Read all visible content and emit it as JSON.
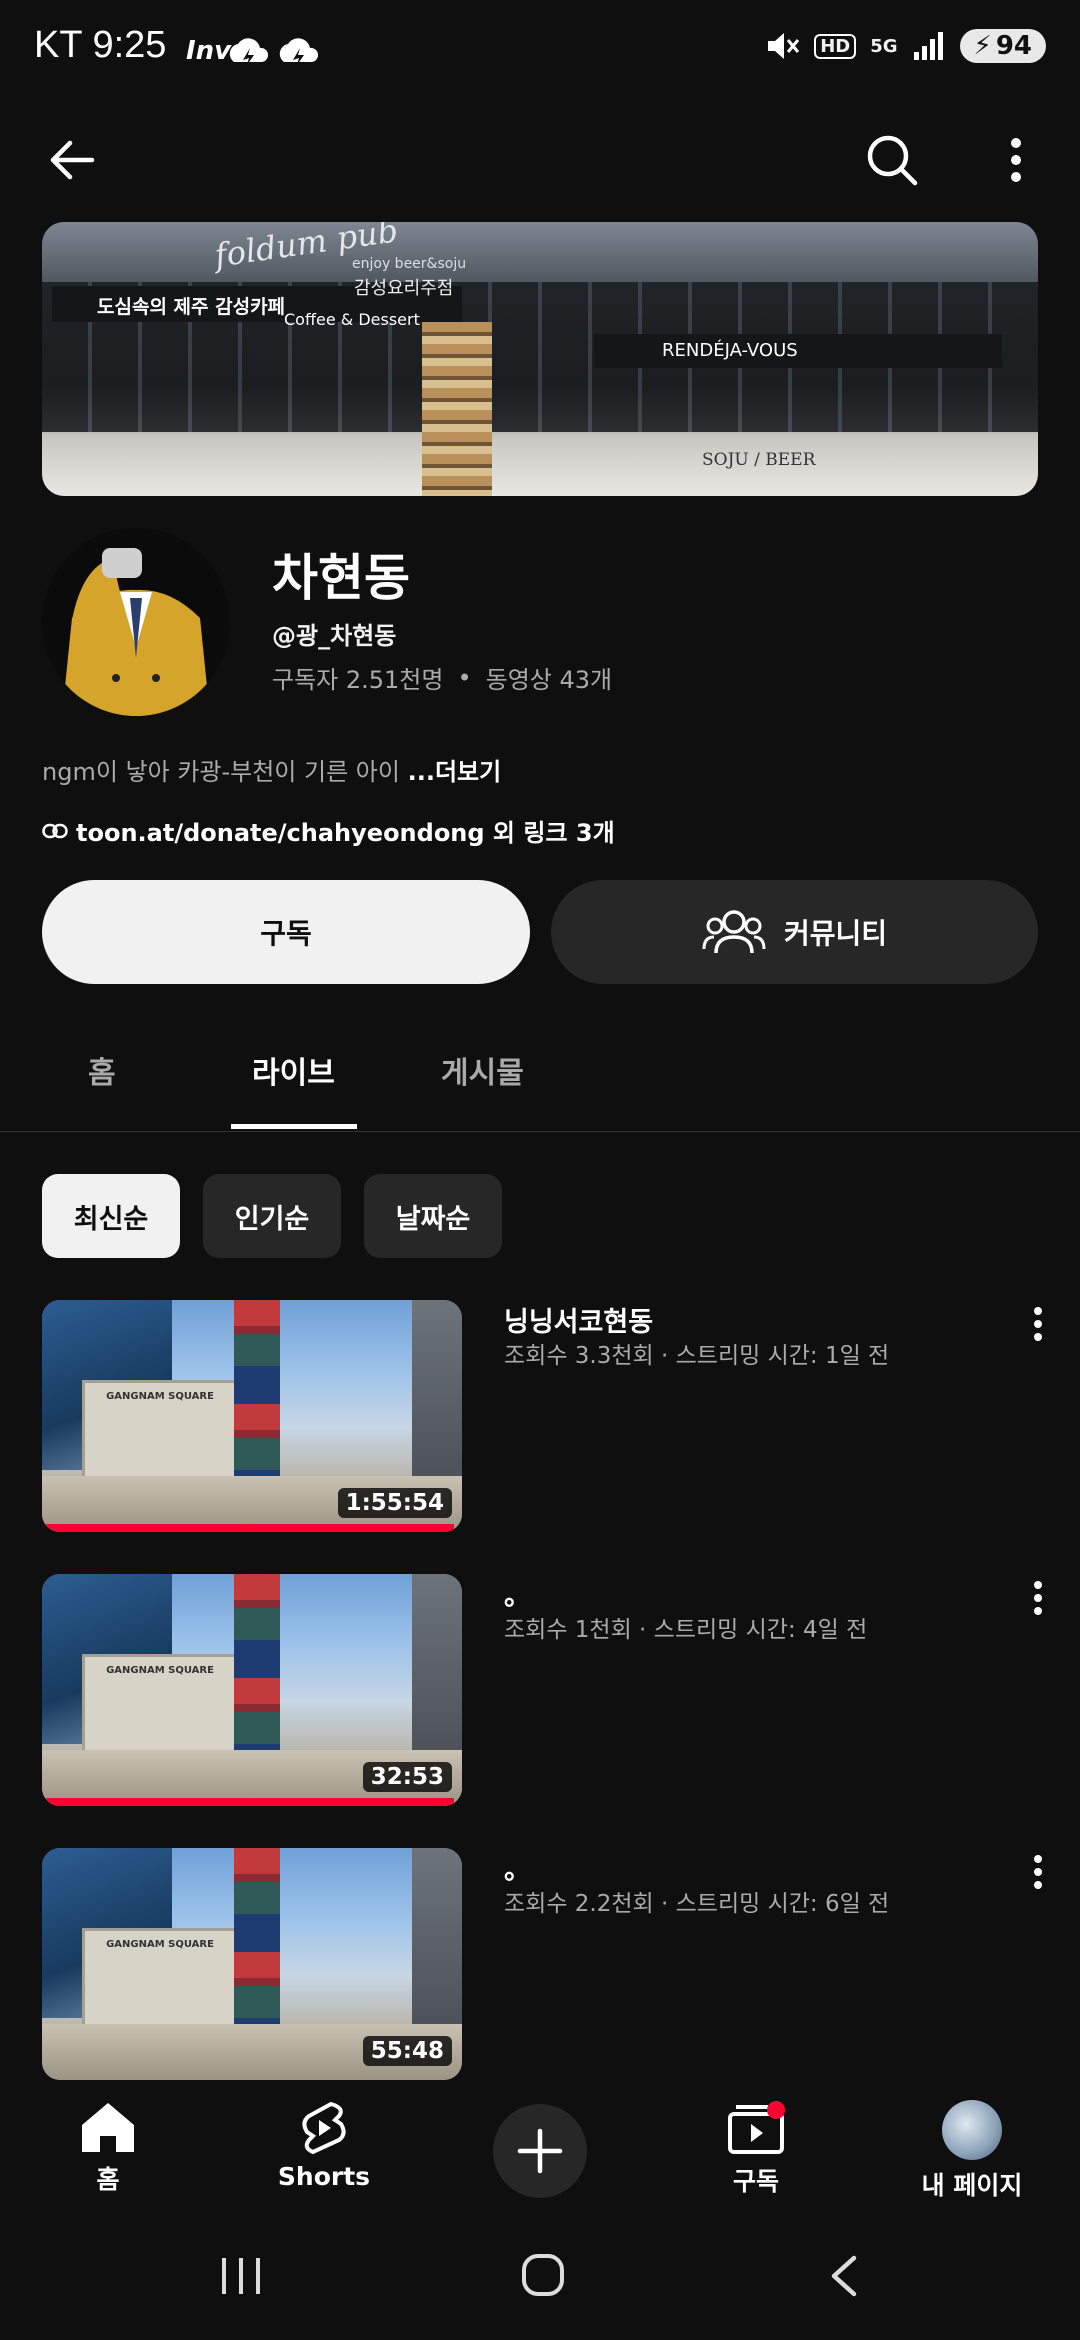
{
  "status_bar": {
    "carrier": "KT",
    "time": "9:25",
    "app_tag": "Inv",
    "network": "5G",
    "hd": "HD",
    "battery": "94"
  },
  "header": {
    "back_icon": "arrow-left-icon",
    "search_icon": "search-icon",
    "more_icon": "more-vert-icon"
  },
  "channel": {
    "name": "차현동",
    "handle": "@광_차현동",
    "subscribers": "구독자 2.51천명",
    "videos": "동영상 43개",
    "description": "ngm이 낳아 카광-부천이 기른 아이 ",
    "more_label": "...더보기",
    "link_text": "toon.at/donate/chahyeondong 외 링크 3개",
    "banner_texts": {
      "script": "foldum pub",
      "sub": "enjoy beer&soju",
      "cafe": "도심속의 제주 감성카페",
      "coffee": "Coffee & Dessert",
      "korean_pub": "감성요리주점",
      "rendez": "RENDÉJA-VOUS",
      "soju": "SOJU / BEER"
    }
  },
  "actions": {
    "subscribe_label": "구독",
    "community_label": "커뮤니티"
  },
  "tabs": [
    {
      "label": "홈",
      "active": false
    },
    {
      "label": "라이브",
      "active": true
    },
    {
      "label": "게시물",
      "active": false
    }
  ],
  "chips": [
    {
      "label": "최신순",
      "active": true
    },
    {
      "label": "인기순",
      "active": false
    },
    {
      "label": "날짜순",
      "active": false
    }
  ],
  "videos": [
    {
      "title": "닝닝서코현동",
      "meta": "조회수 3.3천회 · 스트리밍 시간: 1일 전",
      "duration": "1:55:54",
      "watched": 1.0
    },
    {
      "title": "。",
      "meta": "조회수 1천회 · 스트리밍 시간: 4일 전",
      "duration": "32:53",
      "watched": 1.0
    },
    {
      "title": "。",
      "meta": "조회수 2.2천회 · 스트리밍 시간: 6일 전",
      "duration": "55:48",
      "watched": 0.0
    }
  ],
  "thumb_sign": "GANGNAM SQUARE",
  "bottom_nav": {
    "home": "홈",
    "shorts": "Shorts",
    "subscriptions": "구독",
    "you": "내 페이지"
  },
  "colors": {
    "background": "#0f0f0f",
    "accent_red": "#ff0033",
    "chip_bg": "#272727"
  }
}
